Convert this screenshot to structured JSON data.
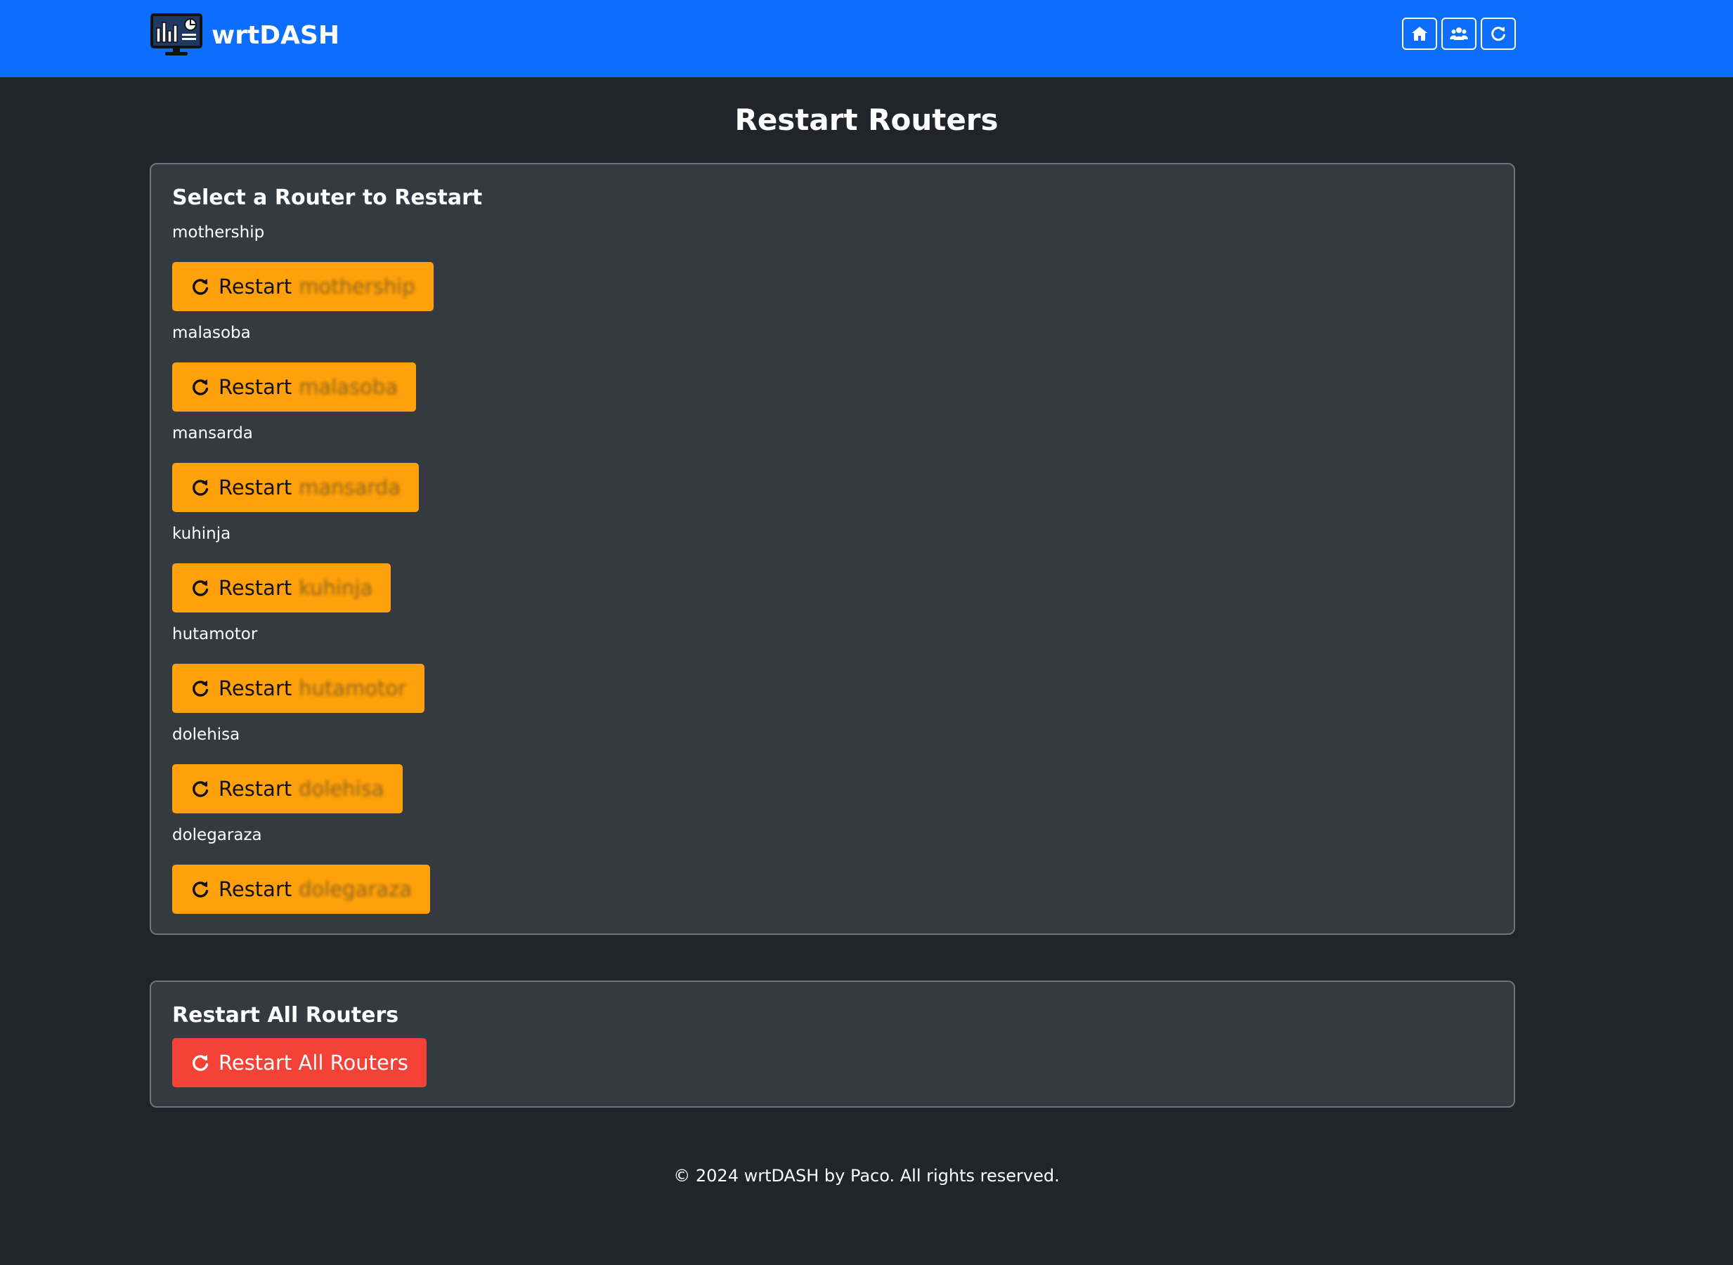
{
  "app": {
    "name": "wrtDASH",
    "logo_icon": "monitor-dashboard-icon"
  },
  "header": {
    "actions": [
      {
        "icon": "home-icon"
      },
      {
        "icon": "users-icon"
      },
      {
        "icon": "refresh-icon"
      }
    ]
  },
  "page": {
    "title": "Restart Routers"
  },
  "router_section": {
    "title": "Select a Router to Restart",
    "button_prefix": "Restart",
    "routers": [
      {
        "name": "mothership",
        "button_suffix": "mothership"
      },
      {
        "name": "malasoba",
        "button_suffix": "malasoba"
      },
      {
        "name": "mansarda",
        "button_suffix": "mansarda"
      },
      {
        "name": "kuhinja",
        "button_suffix": "kuhinja"
      },
      {
        "name": "hutamotor",
        "button_suffix": "hutamotor"
      },
      {
        "name": "dolehisa",
        "button_suffix": "dolehisa"
      },
      {
        "name": "dolegaraza",
        "button_suffix": "dolegaraza"
      }
    ]
  },
  "all_section": {
    "title": "Restart All Routers",
    "button_label": "Restart All Routers"
  },
  "footer": {
    "text": "© 2024 wrtDASH by Paco. All rights reserved."
  },
  "colors": {
    "navbar": "#0d6efd",
    "background": "#212529",
    "card": "#343a40",
    "warning": "#ffa10a",
    "danger": "#f44336"
  }
}
